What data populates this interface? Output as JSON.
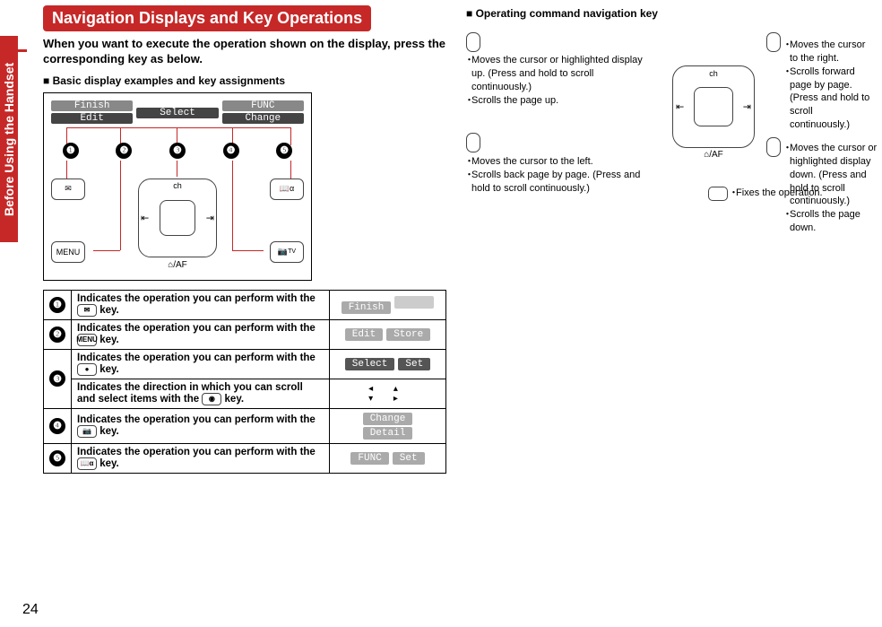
{
  "sideTab": "Before Using the Handset",
  "pageNumber": "24",
  "title": "Navigation Displays and Key Operations",
  "intro": "When you want to execute the operation shown on the display, press the corresponding key as below.",
  "sub1": "Basic display examples and key assignments",
  "softbar": {
    "c1a": "Finish",
    "c1b": "Edit",
    "c2": "Select",
    "c3a": "FUNC",
    "c3b": "Change"
  },
  "nums": {
    "n1": "❶",
    "n2": "❷",
    "n3": "❸",
    "n4": "❹",
    "n5": "❺"
  },
  "keys": {
    "menu": "MENU",
    "tv": "TV",
    "book": "⌂/AF",
    "ch": "ch"
  },
  "table": {
    "r1": {
      "desc": "Indicates the operation you can perform with the ",
      "icon": "✉",
      "tail": " key.",
      "p1": "Finish"
    },
    "r2": {
      "desc": "Indicates the operation you can perform with the ",
      "icon": "MENU",
      "tail": " key.",
      "p1": "Edit",
      "p2": "Store"
    },
    "r3a": {
      "desc": "Indicates the operation you can perform with the ",
      "icon": "●",
      "tail": " key.",
      "p1": "Select",
      "p2": "Set"
    },
    "r3b": {
      "desc": "Indicates the direction in which you can scroll and select items with the ",
      "icon": "◉",
      "tail": " key."
    },
    "r4": {
      "desc": "Indicates the operation you can perform with the ",
      "icon": "📷",
      "tail": " key.",
      "p1": "Change",
      "p2": "Detail"
    },
    "r5": {
      "desc": "Indicates the operation you can perform with the ",
      "icon": "📖α",
      "tail": " key.",
      "p1": "FUNC",
      "p2": "Set"
    }
  },
  "sub2": "Operating command navigation key",
  "nav": {
    "up1": "Moves the cursor or highlighted display up. (Press and hold to scroll continuously.)",
    "up2": "Scrolls the page up.",
    "left1": "Moves the cursor to the left.",
    "left2": "Scrolls back page by page. (Press and hold to scroll continuously.)",
    "right1": "Moves the cursor to the right.",
    "right2": "Scrolls forward page by page. (Press and hold to scroll continuously.)",
    "down1": "Moves the cursor or highlighted display down. (Press and hold to scroll continuously.)",
    "down2": "Scrolls the page down.",
    "center": "Fixes the operation.",
    "chLabel": "ch",
    "afLabel": "⌂/AF"
  }
}
